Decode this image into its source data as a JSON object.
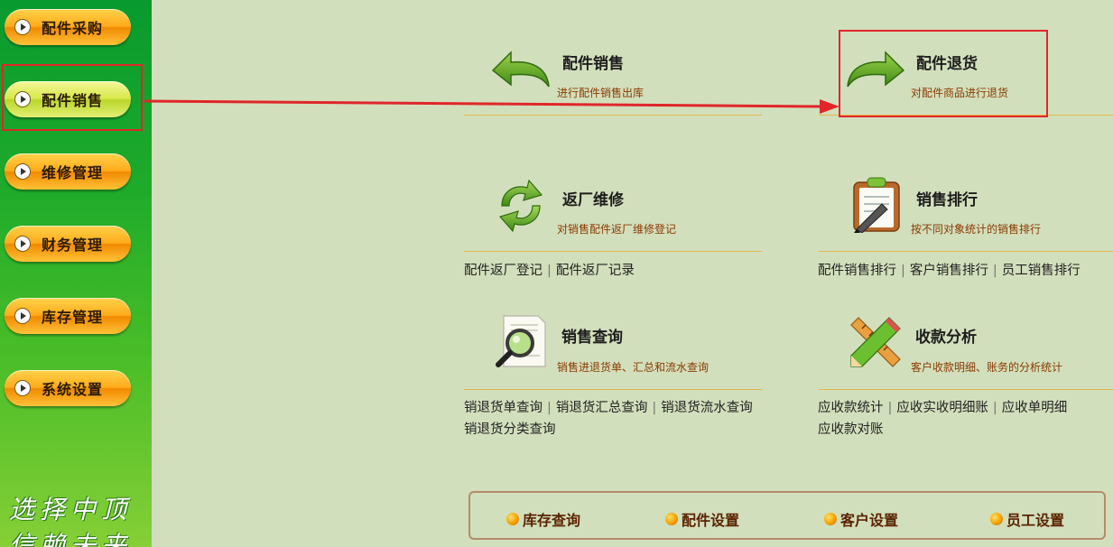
{
  "sidebar": {
    "items": [
      {
        "label": "配件采购"
      },
      {
        "label": "配件销售"
      },
      {
        "label": "维修管理"
      },
      {
        "label": "财务管理"
      },
      {
        "label": "库存管理"
      },
      {
        "label": "系统设置"
      }
    ],
    "slogan": "选择中顶\n信赖未来"
  },
  "modules": {
    "sales": {
      "title": "配件销售",
      "desc": "进行配件销售出库",
      "icon": "undo-arrow-icon"
    },
    "returns": {
      "title": "配件退货",
      "desc": "对配件商品进行退货",
      "icon": "redo-arrow-icon"
    },
    "factory_repair": {
      "title": "返厂维修",
      "desc": "对销售配件返厂维修登记",
      "icon": "refresh-icon",
      "links": [
        "配件返厂登记",
        "配件返厂记录"
      ]
    },
    "ranking": {
      "title": "销售排行",
      "desc": "按不同对象统计的销售排行",
      "icon": "clipboard-pen-icon",
      "links": [
        "配件销售排行",
        "客户销售排行",
        "员工销售排行"
      ]
    },
    "query": {
      "title": "销售查询",
      "desc": "销售进退货单、汇总和流水查询",
      "icon": "magnifier-document-icon",
      "links": [
        "销退货单查询",
        "销退货汇总查询",
        "销退货流水查询",
        "销退货分类查询"
      ]
    },
    "receivables": {
      "title": "收款分析",
      "desc": "客户收款明细、账务的分析统计",
      "icon": "ruler-pencil-icon",
      "links": [
        "应收款统计",
        "应收实收明细账",
        "应收单明细",
        "应收款对账"
      ]
    }
  },
  "quickbar": {
    "items": [
      {
        "label": "库存查询"
      },
      {
        "label": "配件设置"
      },
      {
        "label": "客户设置"
      },
      {
        "label": "员工设置"
      }
    ]
  },
  "colors": {
    "background": "#d2dfbc",
    "highlight_red": "#e0262a",
    "sidebar_green": "#1fab2a",
    "button_orange": "#ffab1b"
  }
}
